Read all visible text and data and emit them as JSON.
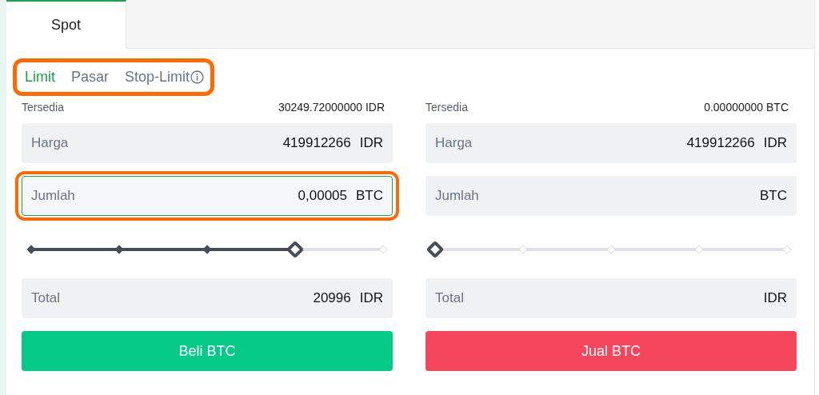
{
  "tabs": [
    {
      "label": "Spot",
      "selected": true
    }
  ],
  "order_types": {
    "highlighted": true,
    "items": [
      {
        "label": "Limit",
        "selected": true,
        "info": false
      },
      {
        "label": "Pasar",
        "selected": false,
        "info": false
      },
      {
        "label": "Stop-Limit",
        "selected": false,
        "info": true
      }
    ]
  },
  "columns": [
    {
      "available_label": "Tersedia",
      "available_value": "30249.72000000 IDR",
      "fields": [
        {
          "label": "Harga",
          "value": "419912266",
          "unit": "IDR",
          "focused": false,
          "highlighted": false
        },
        {
          "label": "Jumlah",
          "value": "0,00005",
          "unit": "BTC",
          "focused": true,
          "highlighted": true
        }
      ],
      "slider": {
        "level": 0.75
      },
      "total": {
        "label": "Total",
        "value": "20996",
        "unit": "IDR"
      },
      "button": {
        "label": "Beli BTC",
        "kind": "buy"
      }
    },
    {
      "available_label": "Tersedia",
      "available_value": "0.00000000 BTC",
      "fields": [
        {
          "label": "Harga",
          "value": "419912266",
          "unit": "IDR",
          "focused": false,
          "highlighted": false
        },
        {
          "label": "Jumlah",
          "unit": "BTC",
          "focused": false,
          "highlighted": false
        }
      ],
      "slider": {
        "level": 0
      },
      "total": {
        "label": "Total",
        "unit": "IDR"
      },
      "button": {
        "label": "Jual BTC",
        "kind": "sell"
      }
    }
  ]
}
